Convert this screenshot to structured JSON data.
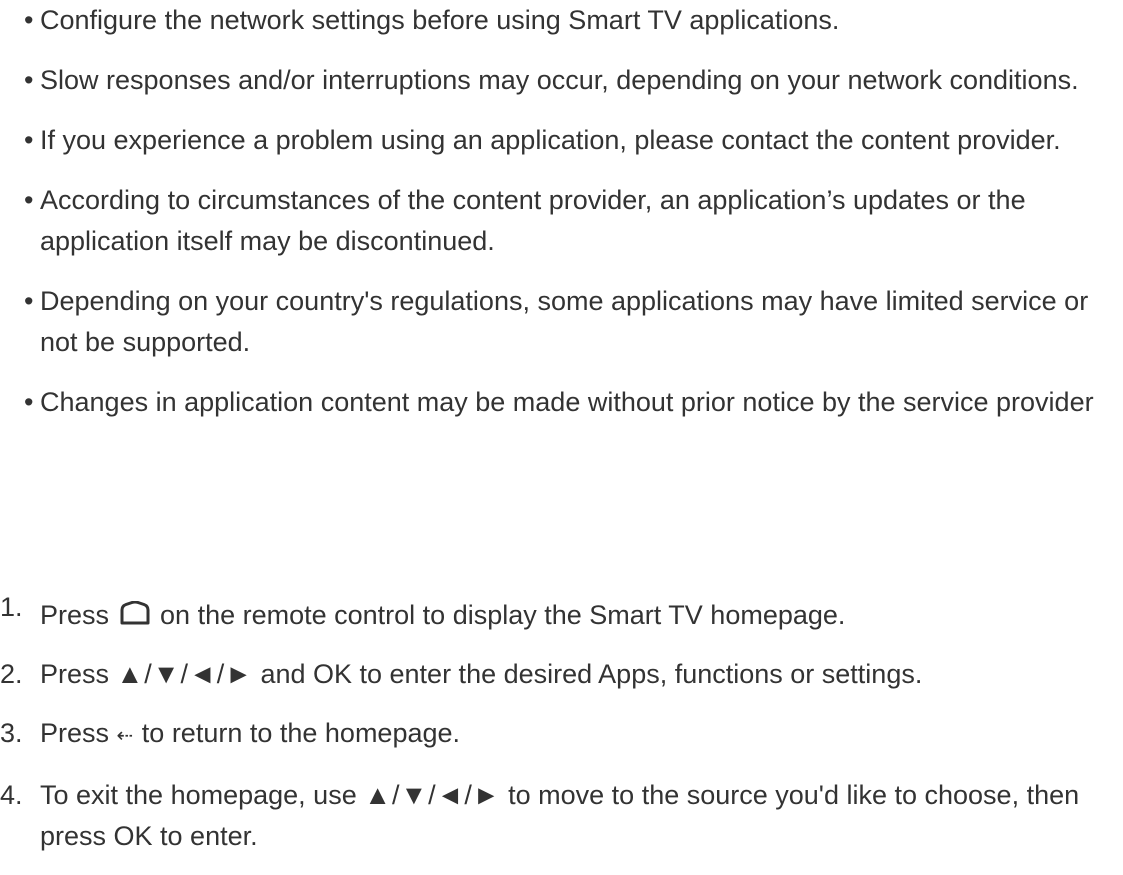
{
  "notes": [
    "Configure the network settings before using Smart TV applications.",
    "Slow responses and/or interruptions may occur, depending on your network conditions.",
    "If you experience a problem using an application, please contact the content provider.",
    "According to circumstances of the content provider, an application’s updates or the application itself may be discontinued.",
    "Depending on your country's regulations, some applications may have limited service or not be supported.",
    "Changes in application content may be made without prior notice by the service provider"
  ],
  "bullet": "•",
  "steps": [
    {
      "number": "1.",
      "before_icon": "Press ",
      "icon": "home-icon",
      "after_icon": " on the remote control to display the Smart TV homepage."
    },
    {
      "number": "2.",
      "before_glyph": "Press ",
      "glyph": "▲/▼/◄/►",
      "after_glyph": " and OK to enter the desired Apps, functions or settings."
    },
    {
      "number": "3.",
      "before_glyph": "Press ",
      "glyph": "⇠",
      "after_glyph": " to return to the homepage."
    },
    {
      "number": "4.",
      "before_glyph": "To exit the homepage, use ",
      "glyph": "▲/▼/◄/►",
      "after_glyph": " to move to the source you'd like to choose, then press OK to enter."
    }
  ]
}
